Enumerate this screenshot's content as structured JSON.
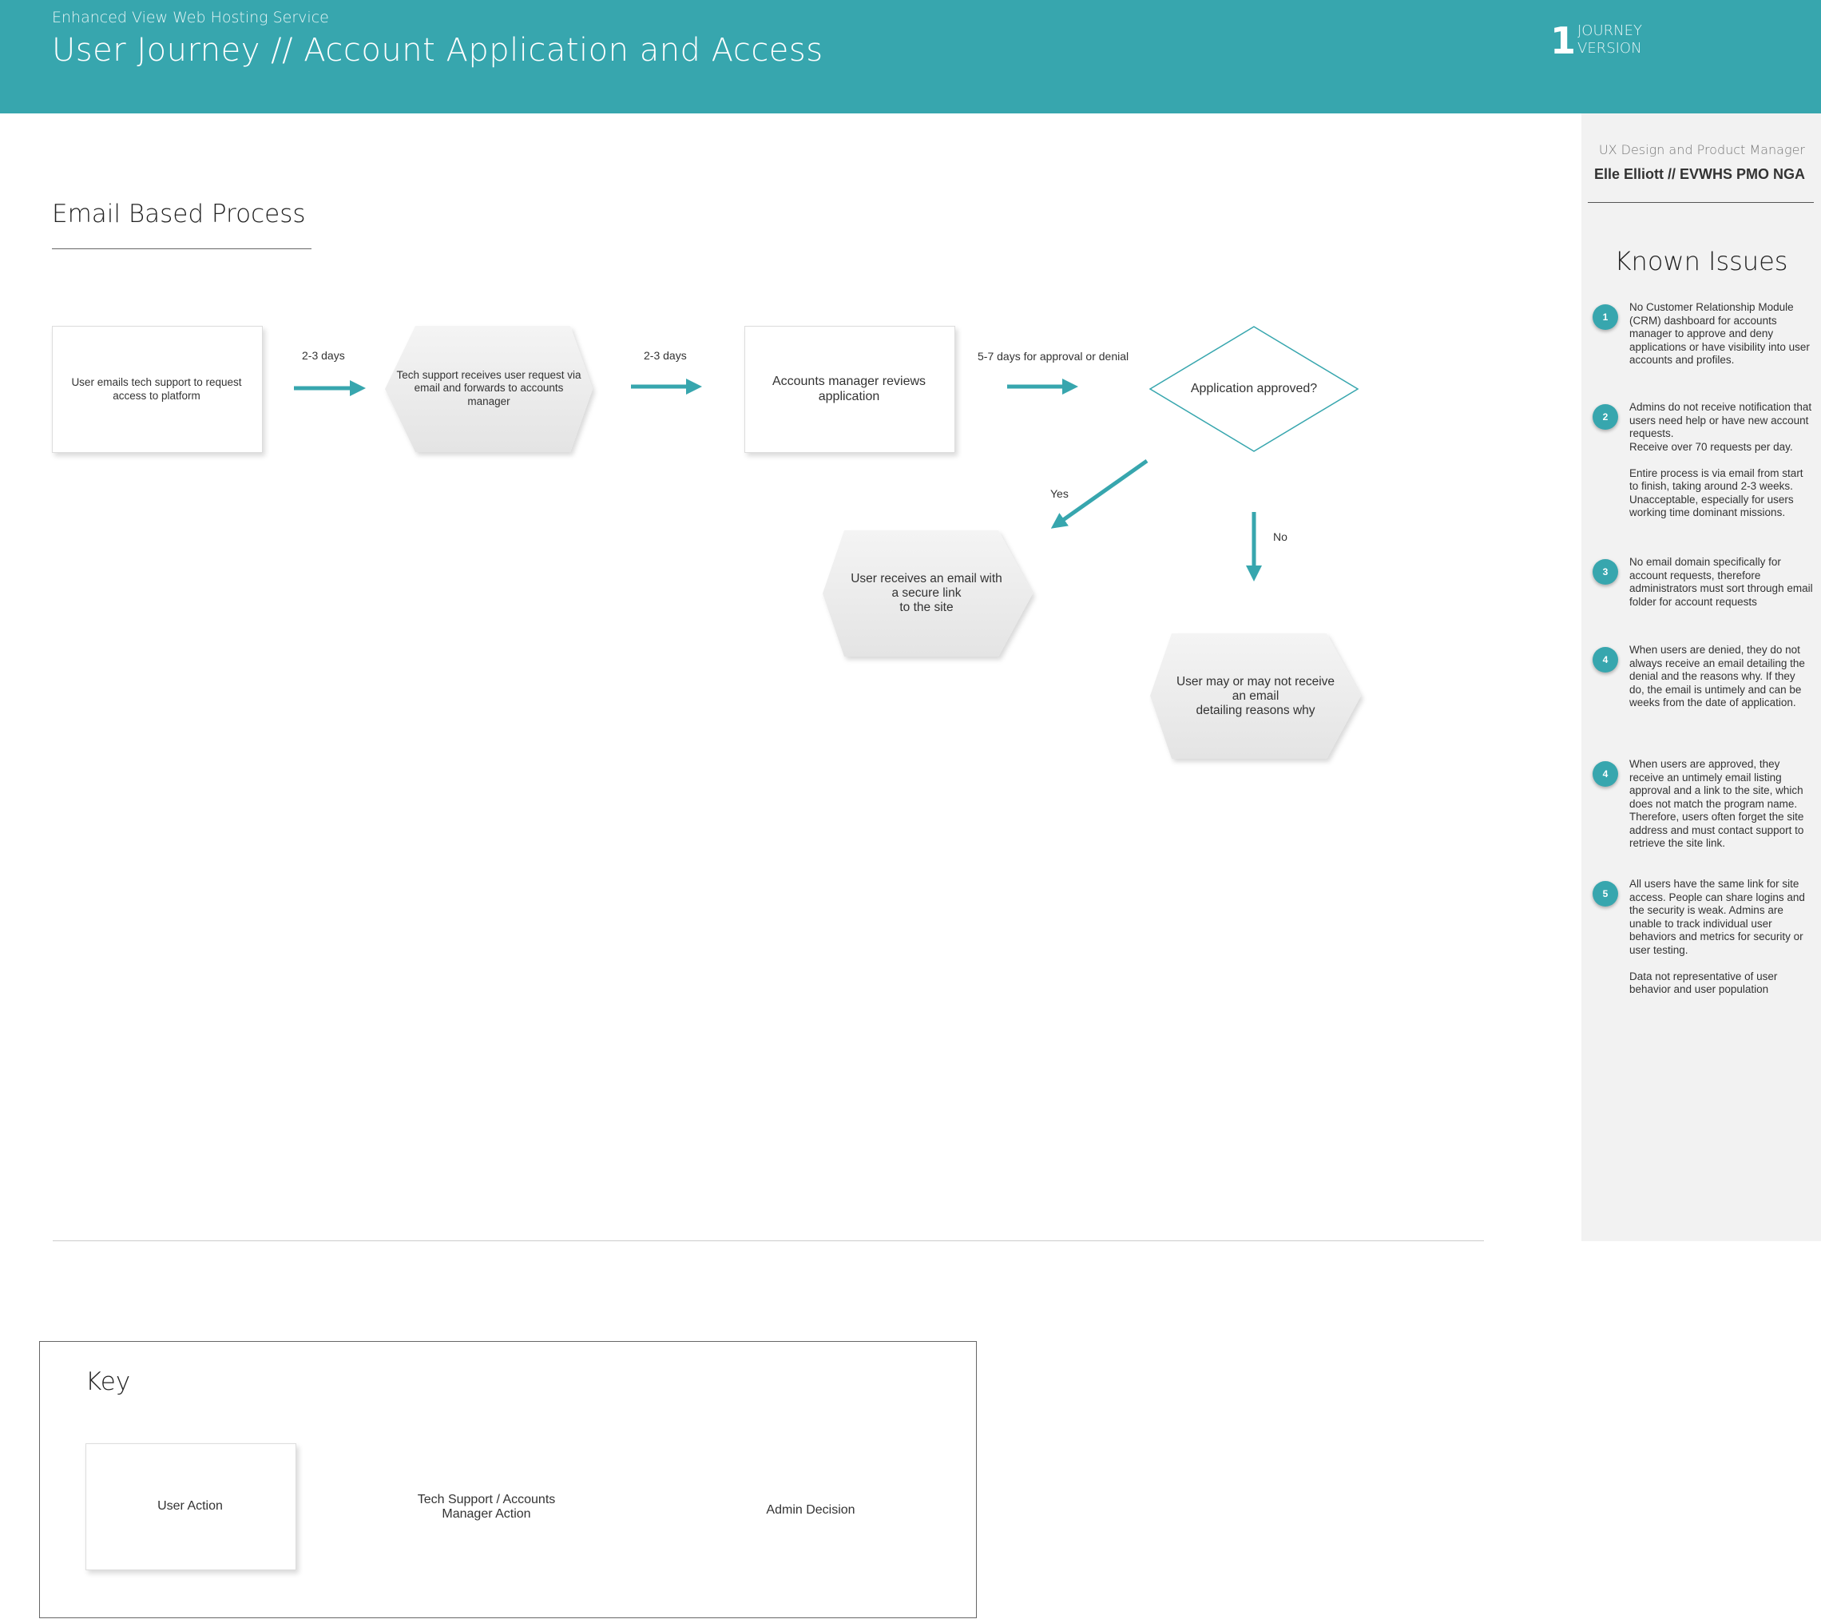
{
  "header": {
    "subtitle": "Enhanced View Web Hosting Service",
    "title": "User Journey // Account Application and Access",
    "version_number": "1",
    "version_label": "JOURNEY\nVERSION"
  },
  "author": {
    "role": "UX Design and Product Manager",
    "name": "Elle Elliott // EVWHS PMO NGA"
  },
  "known_issues": {
    "title": "Known Issues",
    "items": [
      {
        "num": "1",
        "text": "No Customer Relationship Module (CRM) dashboard for accounts manager to approve and deny applications or have visibility into user accounts and profiles."
      },
      {
        "num": "2",
        "text": "Admins do not receive notification that users need help or have new account requests.\nReceive over 70 requests per day.\n\nEntire process is via email from start to finish, taking around 2-3 weeks. Unacceptable, especially for users working time dominant missions."
      },
      {
        "num": "3",
        "text": "No email domain specifically for account requests, therefore administrators must sort through email folder for account requests"
      },
      {
        "num": "4",
        "text": "When users are denied, they do not always receive an email detailing the denial and the reasons why. If they do, the email is untimely and can be weeks from the date of application."
      },
      {
        "num": "4",
        "text": "When users are approved, they receive an untimely email listing approval and a link to the site, which does not match the program name. Therefore, users often forget the site address and must contact support to retrieve the site link."
      },
      {
        "num": "5",
        "text": "All users have the same link for site access. People can share logins and the security is weak. Admins are unable to track individual user behaviors and metrics for security or user testing.\n\nData not representative of user behavior and user population"
      }
    ]
  },
  "process": {
    "title": "Email Based Process",
    "nodes": {
      "user_email": "User emails tech support to request access to platform",
      "tech_support": "Tech support receives user request via email and  forwards to accounts manager",
      "accounts_review": "Accounts manager reviews application",
      "decision": "Application approved?",
      "approved_outcome": "User receives an email with\na secure link\nto the site",
      "denied_outcome": "User may or may not receive\nan email\ndetailing reasons why"
    },
    "edge_labels": {
      "e1": "2-3 days",
      "e2": "2-3 days",
      "e3": "5-7 days for approval or denial",
      "yes": "Yes",
      "no": "No"
    }
  },
  "key": {
    "title": "Key",
    "user_action": "User Action",
    "tech_action": "Tech Support / Accounts\nManager Action",
    "admin_decision": "Admin Decision"
  },
  "colors": {
    "accent": "#37a6ae",
    "sidebar_bg": "#f2f2f2",
    "hexagon_fill": "#ebebeb"
  }
}
